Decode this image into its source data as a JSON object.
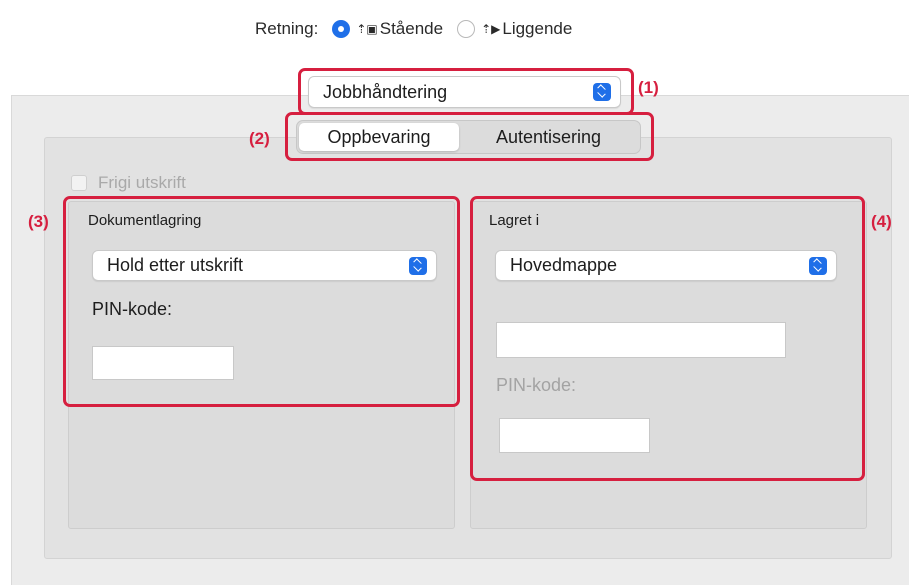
{
  "orientation": {
    "label": "Retning:",
    "portrait": "Stående",
    "landscape": "Liggende",
    "selected": "portrait"
  },
  "menu": {
    "value": "Jobbhåndtering"
  },
  "tabs": [
    {
      "label": "Oppbevaring",
      "active": true
    },
    {
      "label": "Autentisering",
      "active": false
    }
  ],
  "release_print": {
    "label": "Frigi utskrift",
    "checked": false,
    "enabled": false
  },
  "document_storage": {
    "title": "Dokumentlagring",
    "mode": "Hold etter utskrift",
    "pin_label": "PIN-kode:",
    "pin_value": ""
  },
  "stored_in": {
    "title": "Lagret i",
    "folder": "Hovedmappe",
    "folder_name_value": "",
    "pin_label": "PIN-kode:",
    "pin_value": ""
  },
  "callouts": {
    "c1": "(1)",
    "c2": "(2)",
    "c3": "(3)",
    "c4": "(4)"
  },
  "colors": {
    "accent": "#1f6fe8",
    "callout": "#d61f3f"
  }
}
